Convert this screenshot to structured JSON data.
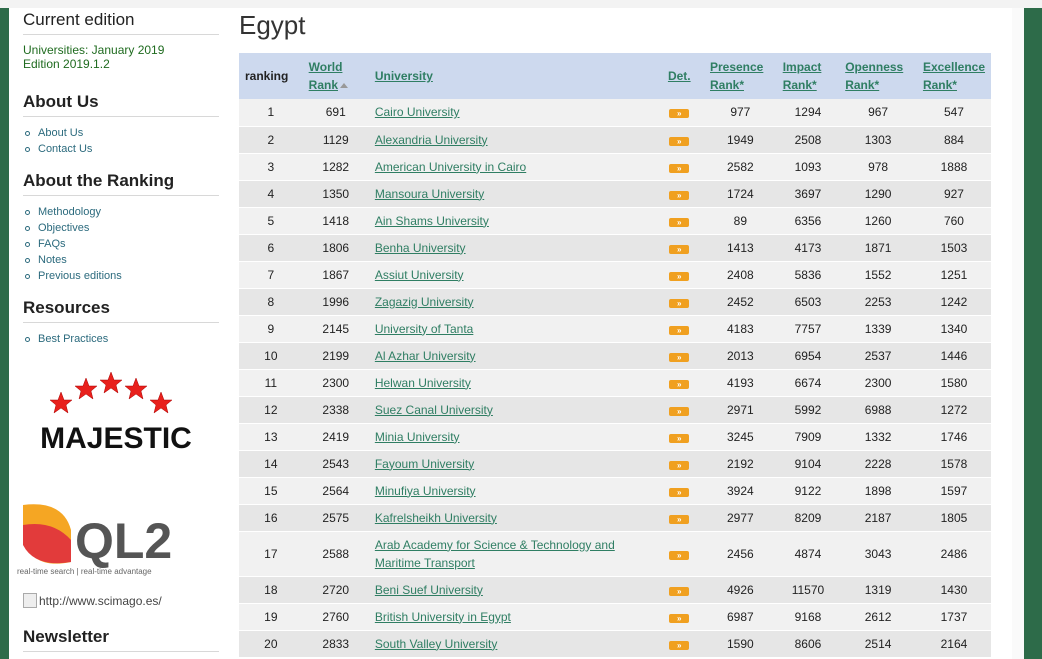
{
  "sidebar": {
    "current_edition_title": "Current edition",
    "edition_line1": "Universities: January 2019",
    "edition_line2": "Edition 2019.1.2",
    "about_us_title": "About Us",
    "about_us_items": [
      "About Us",
      "Contact Us"
    ],
    "about_ranking_title": "About the Ranking",
    "about_ranking_items": [
      "Methodology",
      "Objectives",
      "FAQs",
      "Notes",
      "Previous editions"
    ],
    "resources_title": "Resources",
    "resources_items": [
      "Best Practices"
    ],
    "majestic_logo_text": "MAJESTIC",
    "ql2_logo_text": "QL2",
    "ql2_tagline": "real-time search | real-time advantage",
    "scimago_alt": "http://www.scimago.es/",
    "newsletter_title": "Newsletter"
  },
  "main": {
    "title": "Egypt",
    "headers": {
      "ranking": "ranking",
      "world_rank_1": "World",
      "world_rank_2": "Rank",
      "university": "University",
      "det": "Det.",
      "presence_1": "Presence",
      "presence_2": "Rank*",
      "impact_1": "Impact",
      "impact_2": "Rank*",
      "openness_1": "Openness",
      "openness_2": "Rank*",
      "excellence_1": "Excellence",
      "excellence_2": "Rank*"
    },
    "det_label": "»",
    "rows": [
      {
        "ranking": "1",
        "world": "691",
        "university": "Cairo University",
        "presence": "977",
        "impact": "1294",
        "openness": "967",
        "excellence": "547"
      },
      {
        "ranking": "2",
        "world": "1129",
        "university": "Alexandria University",
        "presence": "1949",
        "impact": "2508",
        "openness": "1303",
        "excellence": "884"
      },
      {
        "ranking": "3",
        "world": "1282",
        "university": "American University in Cairo",
        "presence": "2582",
        "impact": "1093",
        "openness": "978",
        "excellence": "1888"
      },
      {
        "ranking": "4",
        "world": "1350",
        "university": "Mansoura University",
        "presence": "1724",
        "impact": "3697",
        "openness": "1290",
        "excellence": "927"
      },
      {
        "ranking": "5",
        "world": "1418",
        "university": "Ain Shams University",
        "presence": "89",
        "impact": "6356",
        "openness": "1260",
        "excellence": "760"
      },
      {
        "ranking": "6",
        "world": "1806",
        "university": "Benha University",
        "presence": "1413",
        "impact": "4173",
        "openness": "1871",
        "excellence": "1503"
      },
      {
        "ranking": "7",
        "world": "1867",
        "university": "Assiut University",
        "presence": "2408",
        "impact": "5836",
        "openness": "1552",
        "excellence": "1251"
      },
      {
        "ranking": "8",
        "world": "1996",
        "university": "Zagazig University",
        "presence": "2452",
        "impact": "6503",
        "openness": "2253",
        "excellence": "1242"
      },
      {
        "ranking": "9",
        "world": "2145",
        "university": "University of Tanta",
        "presence": "4183",
        "impact": "7757",
        "openness": "1339",
        "excellence": "1340"
      },
      {
        "ranking": "10",
        "world": "2199",
        "university": "Al Azhar University",
        "presence": "2013",
        "impact": "6954",
        "openness": "2537",
        "excellence": "1446"
      },
      {
        "ranking": "11",
        "world": "2300",
        "university": "Helwan University",
        "presence": "4193",
        "impact": "6674",
        "openness": "2300",
        "excellence": "1580"
      },
      {
        "ranking": "12",
        "world": "2338",
        "university": "Suez Canal University",
        "presence": "2971",
        "impact": "5992",
        "openness": "6988",
        "excellence": "1272"
      },
      {
        "ranking": "13",
        "world": "2419",
        "university": "Minia University",
        "presence": "3245",
        "impact": "7909",
        "openness": "1332",
        "excellence": "1746"
      },
      {
        "ranking": "14",
        "world": "2543",
        "university": "Fayoum University",
        "presence": "2192",
        "impact": "9104",
        "openness": "2228",
        "excellence": "1578"
      },
      {
        "ranking": "15",
        "world": "2564",
        "university": "Minufiya University",
        "presence": "3924",
        "impact": "9122",
        "openness": "1898",
        "excellence": "1597"
      },
      {
        "ranking": "16",
        "world": "2575",
        "university": "Kafrelsheikh University",
        "presence": "2977",
        "impact": "8209",
        "openness": "2187",
        "excellence": "1805"
      },
      {
        "ranking": "17",
        "world": "2588",
        "university": "Arab Academy for Science & Technology and Maritime Transport",
        "presence": "2456",
        "impact": "4874",
        "openness": "3043",
        "excellence": "2486"
      },
      {
        "ranking": "18",
        "world": "2720",
        "university": "Beni Suef University",
        "presence": "4926",
        "impact": "11570",
        "openness": "1319",
        "excellence": "1430"
      },
      {
        "ranking": "19",
        "world": "2760",
        "university": "British University in Egypt",
        "presence": "6987",
        "impact": "9168",
        "openness": "2612",
        "excellence": "1737"
      },
      {
        "ranking": "20",
        "world": "2833",
        "university": "South Valley University",
        "presence": "1590",
        "impact": "8606",
        "openness": "2514",
        "excellence": "2164"
      }
    ]
  }
}
